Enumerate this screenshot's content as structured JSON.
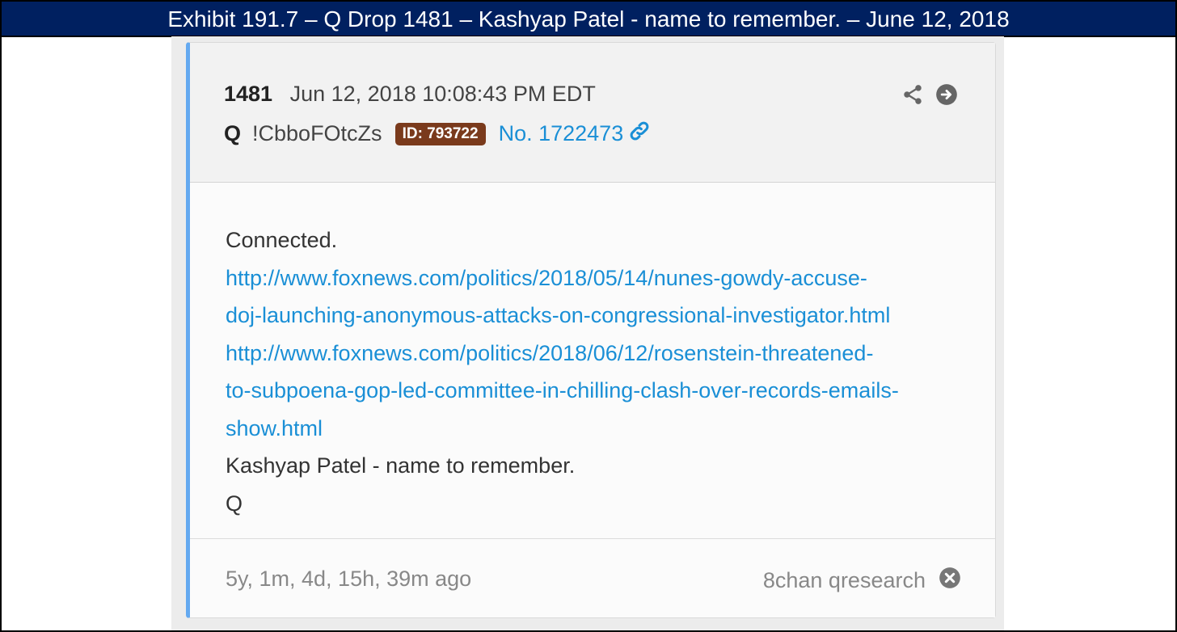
{
  "exhibit": {
    "title": "Exhibit 191.7 – Q Drop 1481 – Kashyap Patel - name to remember. – June 12, 2018"
  },
  "post": {
    "number": "1481",
    "date": "Jun 12, 2018 10:08:43 PM EDT",
    "author": "Q",
    "tripcode": "!CbboFOtcZs",
    "id_badge": "ID: 793722",
    "post_no": "No. 1722473",
    "icons": [
      "share-icon",
      "arrow-circle-right-icon",
      "link-icon",
      "close-circle-icon"
    ],
    "body": {
      "line1": "Connected.",
      "link1_a": "http://www.foxnews.com/politics/2018/05/14/nunes-gowdy-accuse-",
      "link1_b": "doj-launching-anonymous-attacks-on-congressional-investigator.html",
      "link2_a": "http://www.foxnews.com/politics/2018/06/12/rosenstein-threatened-",
      "link2_b": "to-subpoena-gop-led-committee-in-chilling-clash-over-records-emails-",
      "link2_c": "show.html",
      "line_name": "Kashyap Patel - name to remember.",
      "signature": "Q"
    },
    "footer": {
      "age": "5y, 1m, 4d, 15h, 39m ago",
      "board": "8chan qresearch"
    },
    "colors": {
      "accent": "#64a9f0",
      "link": "#1a8fd6",
      "badge": "#7a3a1c",
      "title_bar": "#002060"
    }
  }
}
